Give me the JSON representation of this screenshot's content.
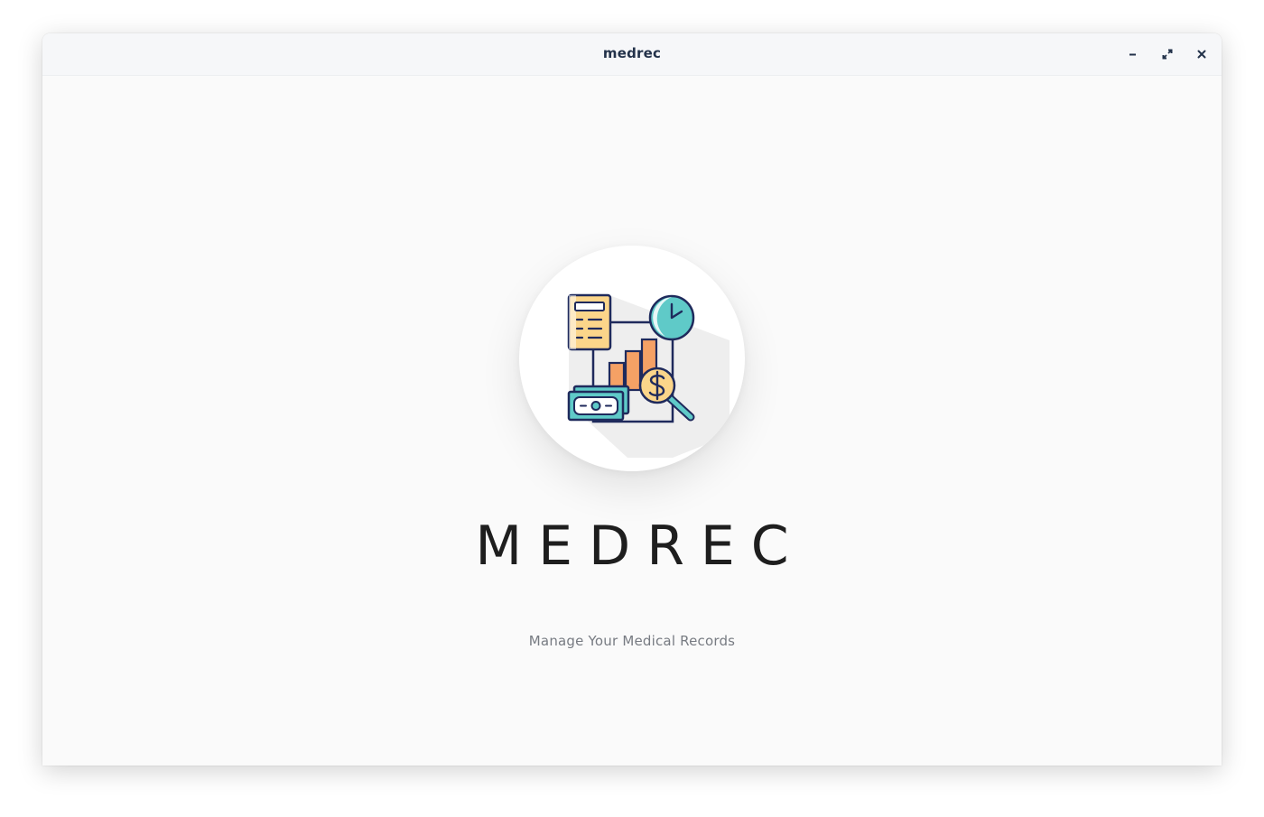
{
  "window": {
    "title": "medrec",
    "controls": {
      "minimize_icon": "minimize-icon",
      "maximize_icon": "maximize-icon",
      "close_icon": "close-icon"
    }
  },
  "splash": {
    "logo_icon": "finance-report-icon",
    "app_name": "MEDREC",
    "tagline": "Manage Your Medical Records"
  },
  "colors": {
    "titlebar_bg": "#f6f7f9",
    "content_bg": "#fafafa",
    "title_text": "#23324a",
    "app_name_text": "#1e1e1e",
    "tagline_text": "#777b82",
    "icon_outline": "#1f2a5c",
    "icon_yellow": "#fbd58a",
    "icon_orange": "#f5a165",
    "icon_teal": "#5fcac8"
  }
}
